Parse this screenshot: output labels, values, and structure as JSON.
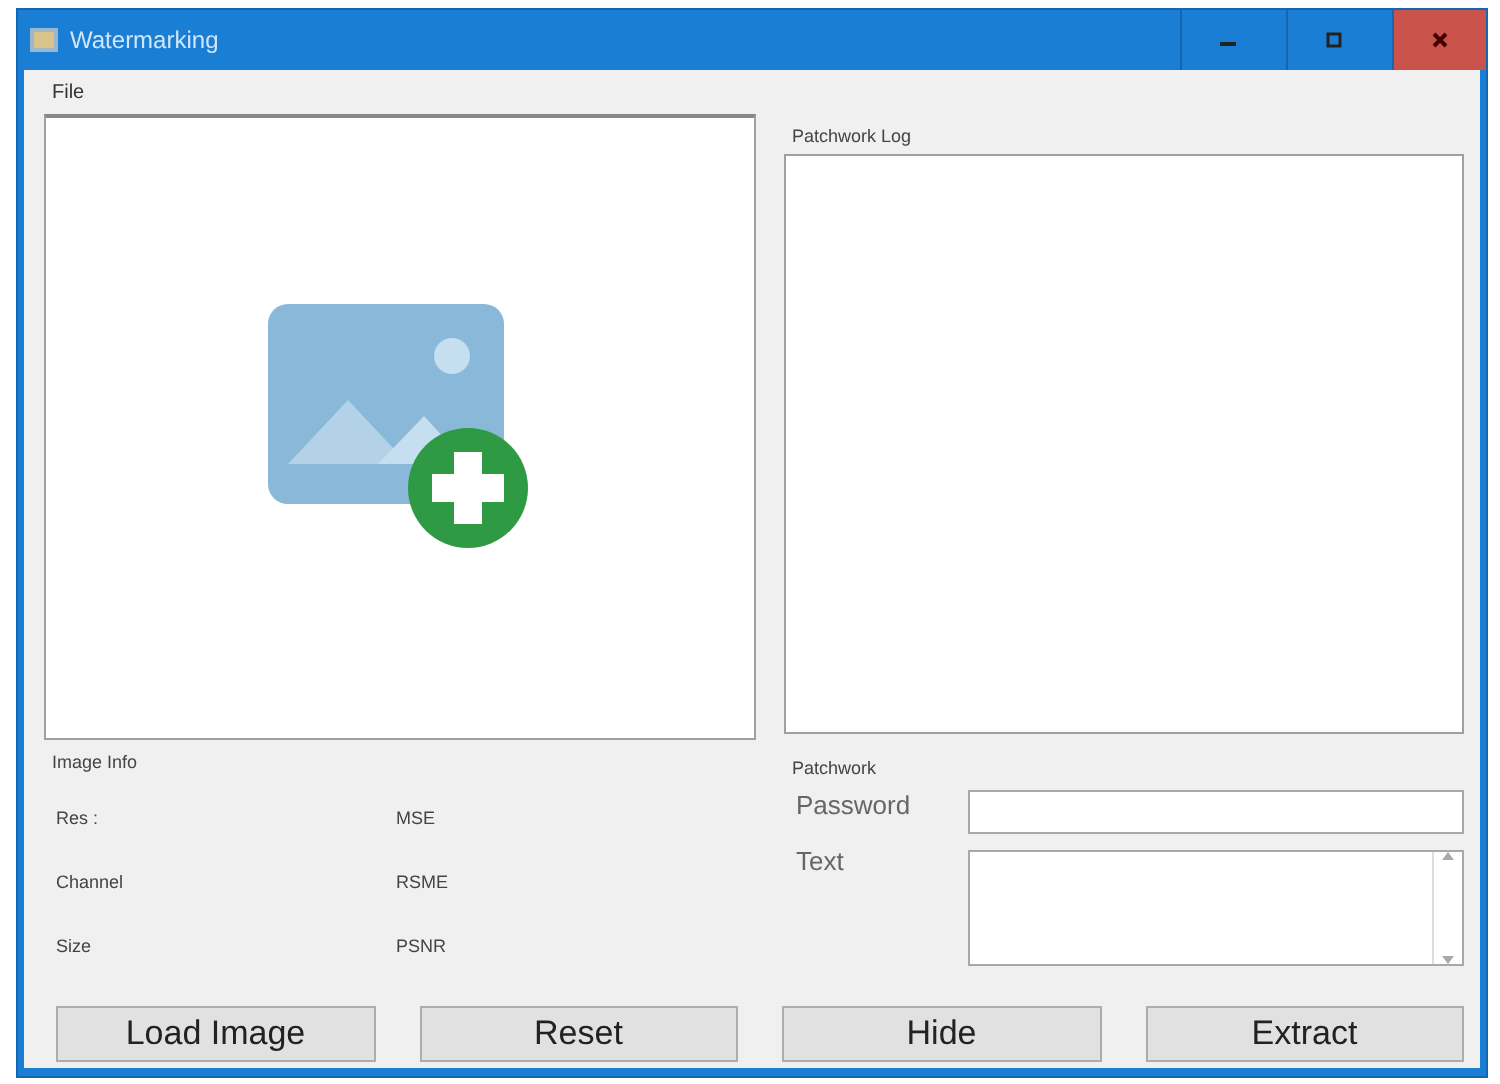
{
  "window": {
    "title": "Watermarking"
  },
  "menu": [
    "File"
  ],
  "log": {
    "label": "Patchwork Log"
  },
  "image_info": {
    "label": "Image Info",
    "fields": [
      {
        "label": "Res :",
        "metric": "MSE"
      },
      {
        "label": "Channel",
        "metric": "RSME"
      },
      {
        "label": "Size",
        "metric": "PSNR"
      }
    ]
  },
  "patchwork": {
    "label": "Patchwork",
    "password_label": "Password",
    "text_label": "Text"
  },
  "buttons": [
    "Load Image",
    "Reset",
    "Hide",
    "Extract"
  ]
}
